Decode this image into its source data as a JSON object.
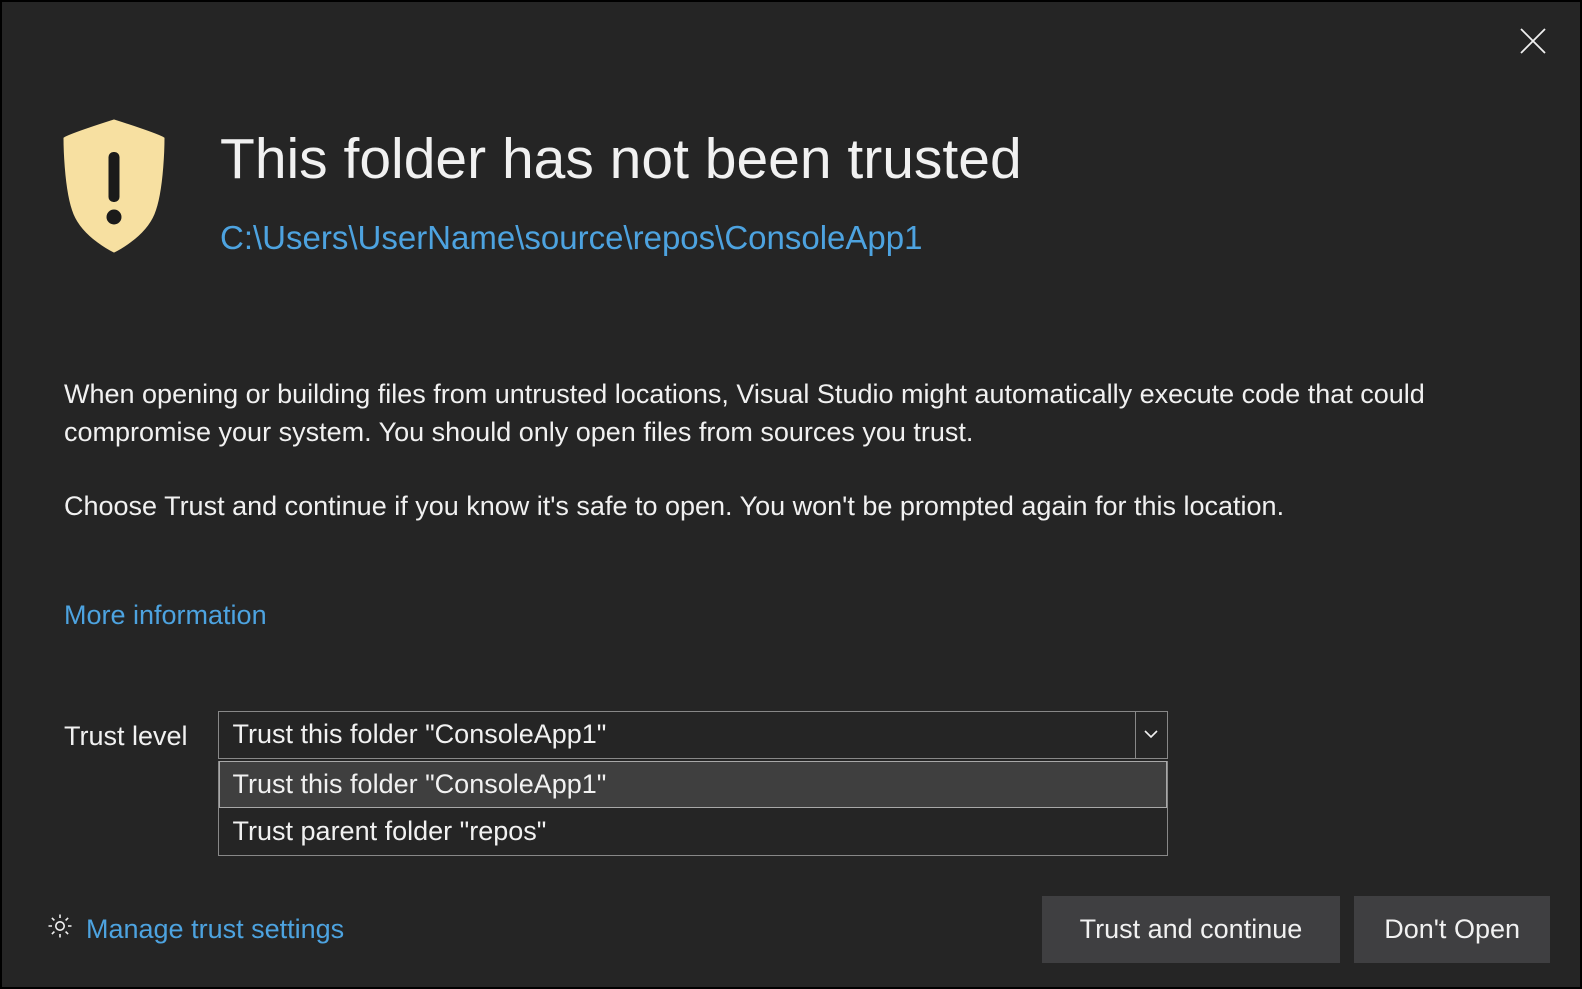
{
  "dialog": {
    "title": "This folder has not been trusted",
    "path": "C:\\Users\\UserName\\source\\repos\\ConsoleApp1",
    "body1": "When opening or building files from untrusted locations, Visual Studio might automatically execute code that could compromise your system. You should only open files from sources you trust.",
    "body2": "Choose Trust and continue if you know it's safe to open. You won't be prompted again for this location.",
    "more_info": "More information",
    "trust_level_label": "Trust level",
    "selected_option": "Trust this folder \"ConsoleApp1\"",
    "options": [
      "Trust this folder \"ConsoleApp1\"",
      "Trust parent folder \"repos\""
    ],
    "manage_trust": "Manage trust settings",
    "trust_button": "Trust and continue",
    "dont_open_button": "Don't Open"
  }
}
